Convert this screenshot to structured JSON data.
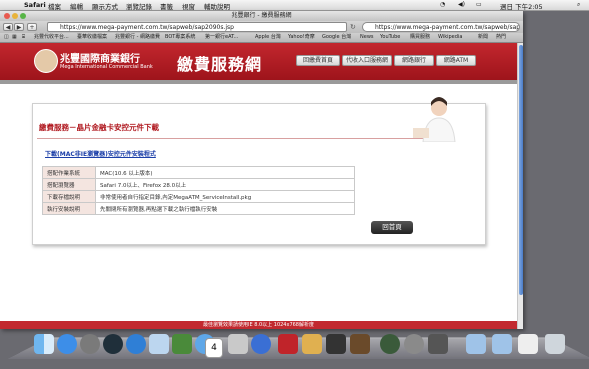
{
  "menubar": {
    "apple": "",
    "app": "Safari",
    "items": [
      "檔案",
      "編輯",
      "顯示方式",
      "瀏覽記錄",
      "書籤",
      "視窗",
      "輔助說明"
    ],
    "clock": "週日 下午2:05"
  },
  "window": {
    "title": "兆豐銀行 - 繳費服務網",
    "url": "https://www.mega-payment.com.tw/sapweb/sap2090s.jsp",
    "search": "https://www.mega-payment.com.tw/sapweb/sap20",
    "bookmarks": [
      "兆豐代收平台...",
      "臺華收繳檔案",
      "兆豐銀行 - 網路繳費",
      "BOT專案系統",
      "第一銀行eAT...",
      "Apple 台灣",
      "Yahoo!奇摩",
      "Google 台灣",
      "News",
      "YouTube",
      "購買服務",
      "Wikipedia",
      "新聞",
      "熱門"
    ]
  },
  "page": {
    "bank_name": "兆豐國際商業銀行",
    "bank_name_en": "Mega International Commercial Bank",
    "site_title": "繳費服務網",
    "nav": [
      "回繳費首頁",
      "代收入口服務網",
      "網路銀行",
      "網路ATM"
    ],
    "panel_title": "繳費服務－晶片金融卡安控元件下載",
    "download_link": "下載(MAC非IE瀏覽器)安控元件安裝程式",
    "table": [
      {
        "label": "搭配作業系統",
        "value": "MAC(10.6 以上版本)"
      },
      {
        "label": "搭配瀏覽器",
        "value": "Safari 7.0以上、Firefox 28.0以上"
      },
      {
        "label": "下載存檔說明",
        "value": "非常使用者自行指定目錄,內定MegaATM_ServiceInstall.pkg"
      },
      {
        "label": "執行安裝說明",
        "value": "先關閉所有瀏覽器,再點選下載之執行檔執行安裝"
      }
    ],
    "home_button": "回首頁",
    "footer": "最佳瀏覽效果請使用IE 8.0以上 1024x768解析度"
  },
  "dock": [
    "finder",
    "app-store",
    "launchpad",
    "dashboard",
    "safari",
    "mail",
    "facetime",
    "messages",
    "calendar",
    "preview",
    "itunes",
    "photo-booth",
    "iphoto",
    "garageband",
    "imovie",
    "time-machine",
    "system-preferences",
    "downloads",
    "documents",
    "applications",
    "trash"
  ]
}
